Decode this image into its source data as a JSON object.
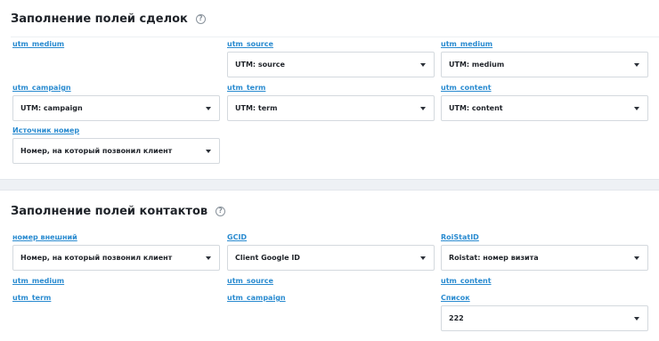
{
  "deal_section": {
    "title": "Заполнение полей сделок",
    "fields": [
      {
        "label": "utm_medium"
      },
      {
        "label": "utm_source",
        "value": "UTM: source"
      },
      {
        "label": "utm_medium",
        "value": "UTM: medium"
      },
      {
        "label": "utm_campaign",
        "value": "UTM: campaign"
      },
      {
        "label": "utm_term",
        "value": "UTM: term"
      },
      {
        "label": "utm_content",
        "value": "UTM: content"
      },
      {
        "label": "Источник номер",
        "value": "Номер, на который позвонил клиент"
      }
    ]
  },
  "contact_section": {
    "title": "Заполнение полей контактов",
    "fields": [
      {
        "label": "номер внешний",
        "value": "Номер, на который позвонил клиент"
      },
      {
        "label": "GCID",
        "value": "Client Google ID"
      },
      {
        "label": "RoiStatID",
        "value": "Roistat: номер визита"
      },
      {
        "label": "utm_medium"
      },
      {
        "label": "utm_source"
      },
      {
        "label": "utm_content"
      },
      {
        "label": "utm_term"
      },
      {
        "label": "utm_campaign"
      },
      {
        "label": "Список",
        "value": "222"
      }
    ]
  }
}
